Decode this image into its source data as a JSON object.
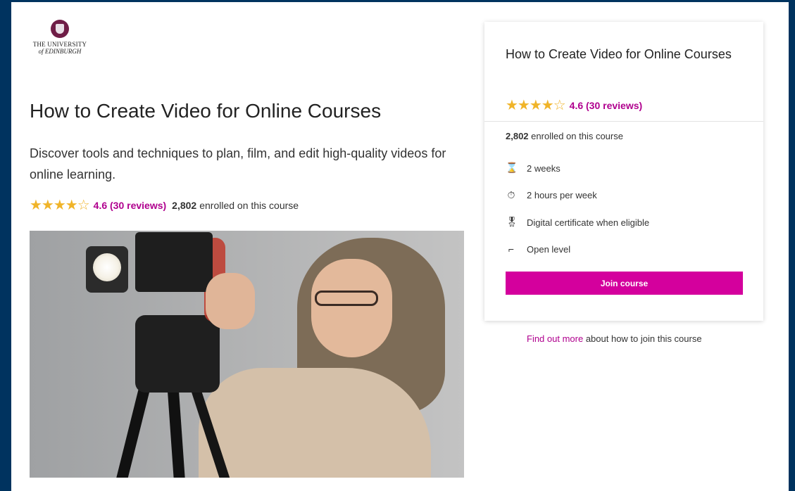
{
  "logo": {
    "line1": "THE UNIVERSITY",
    "line2": "of EDINBURGH"
  },
  "course": {
    "title": "How to Create Video for Online Courses",
    "subtitle": "Discover tools and techniques to plan, film, and edit high-quality videos for online learning.",
    "stars": "★★★★☆",
    "rating_text": "4.6 (30 reviews)",
    "enrolled_count": "2,802",
    "enrolled_text": "enrolled on this course"
  },
  "card": {
    "title": "How to Create Video for Online Courses",
    "stars": "★★★★☆",
    "rating_text": "4.6 (30 reviews)",
    "enrolled_count": "2,802",
    "enrolled_text": "enrolled on this course",
    "facts": [
      {
        "icon": "hourglass-icon",
        "glyph": "⌛",
        "label": "2 weeks"
      },
      {
        "icon": "stopwatch-icon",
        "glyph": "⏱",
        "label": "2 hours per week"
      },
      {
        "icon": "certificate-icon",
        "glyph": "🎖",
        "label": "Digital certificate when eligible"
      },
      {
        "icon": "stairs-icon",
        "glyph": "⌐",
        "label": "Open level"
      }
    ],
    "join_label": "Join course"
  },
  "find_more": {
    "link": "Find out more",
    "text": " about how to join this course"
  },
  "colors": {
    "accent": "#d4009d",
    "link": "#b0008e",
    "star": "#f0b429",
    "frame": "#00335f"
  }
}
